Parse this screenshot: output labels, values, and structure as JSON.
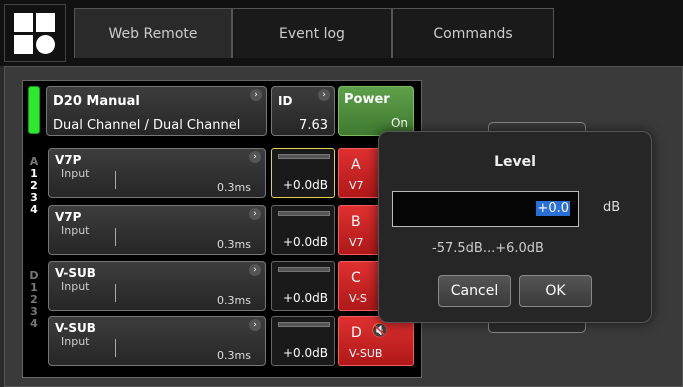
{
  "tabs": [
    {
      "label": "Web Remote"
    },
    {
      "label": "Event log"
    },
    {
      "label": "Commands"
    }
  ],
  "device": {
    "name": "D20 Manual",
    "mode": "Dual Channel / Dual Channel",
    "id_label": "ID",
    "id_value": "7.63",
    "power_label": "Power",
    "power_state": "On",
    "status_led_color": "#2ee82e"
  },
  "group_labels": {
    "a": [
      "A",
      "1",
      "2",
      "3",
      "4"
    ],
    "d": [
      "D",
      "1",
      "2",
      "3",
      "4"
    ]
  },
  "channels": [
    {
      "name": "V7P",
      "input": "Input",
      "delay": "0.3ms",
      "gain": "+0.0dB",
      "out_letter": "A",
      "out_sub": "V7"
    },
    {
      "name": "V7P",
      "input": "Input",
      "delay": "0.3ms",
      "gain": "+0.0dB",
      "out_letter": "B",
      "out_sub": "V7"
    },
    {
      "name": "V-SUB",
      "input": "Input",
      "delay": "0.3ms",
      "gain": "+0.0dB",
      "out_letter": "C",
      "out_sub": "V-S"
    },
    {
      "name": "V-SUB",
      "input": "Input",
      "delay": "0.3ms",
      "gain": "+0.0dB",
      "out_letter": "D",
      "out_sub": "V-SUB"
    }
  ],
  "dialog": {
    "title": "Level",
    "value": "+0.0",
    "unit": "dB",
    "range": "-57.5dB...+6.0dB",
    "cancel": "Cancel",
    "ok": "OK"
  },
  "colors": {
    "output_red": "#d02020",
    "power_green": "#4f8f3c",
    "selection": "#e0d24a"
  }
}
